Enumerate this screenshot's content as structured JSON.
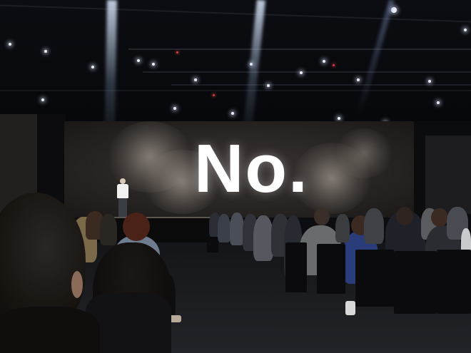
{
  "screen": {
    "headline": "No."
  },
  "colors": {
    "background": "#07090c",
    "screen_text": "#ffffff",
    "presenter_shirt": "#f0f0f0"
  }
}
